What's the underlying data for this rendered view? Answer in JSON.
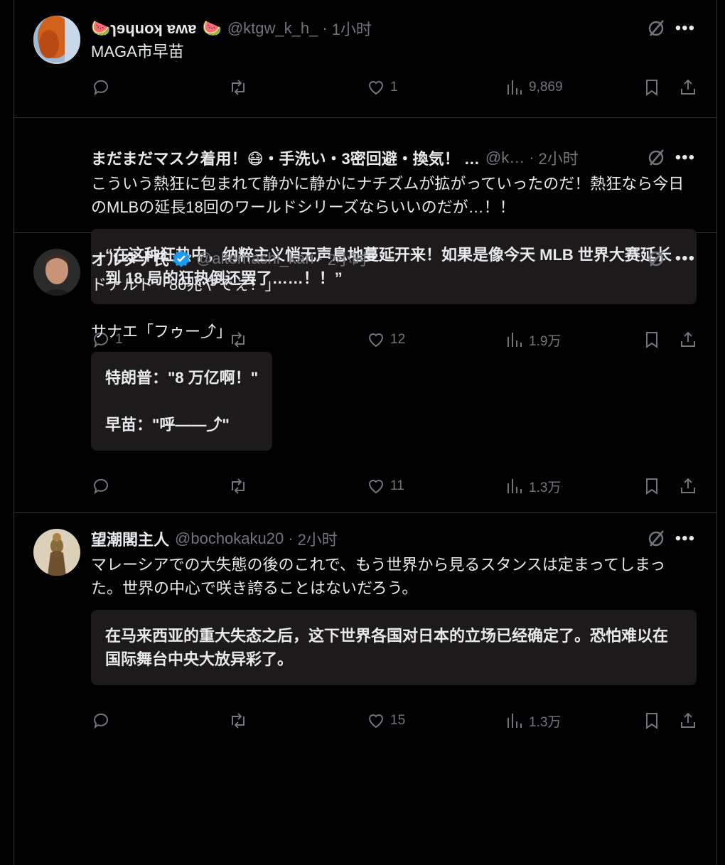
{
  "posts": [
    {
      "name": "🍉ɿɘɥuoʞ ɐʍɐ",
      "name_suffix": "🍉",
      "handle": "@ktgw_k_h_",
      "time": "1小时",
      "text": "MAGA市早苗",
      "translation": "",
      "replies": "",
      "reposts": "",
      "likes": "1",
      "views": "9,869"
    },
    {
      "name": "まだまだマスク着用！😷・手洗い・3密回避・換気！ …",
      "handle": "@k…",
      "time": "2小时",
      "text": "こういう熱狂に包まれて静かに静かにナチズムが拡がっていったのだ！熱狂なら今日のMLBの延長18回のワールドシリーズならいいのだが…！！",
      "translation": "“在这种狂热中，纳粹主义悄无声息地蔓延开来！如果是像今天 MLB 世界大赛延长到 18 局的狂热倒还罢了……！！”",
      "replies": "1",
      "reposts": "",
      "likes": "12",
      "views": "1.9万"
    },
    {
      "name": "オルタナ氏",
      "handle": "@alternashi_kari",
      "time": "2小时",
      "text": "ドナルド「80兆やでぇ！」\n\nサナエ「フゥー⤴」",
      "translation": "特朗普：\"8 万亿啊！\"\n\n早苗：\"呼——⤴\"",
      "replies": "",
      "reposts": "",
      "likes": "11",
      "views": "1.3万"
    },
    {
      "name": "望潮閣主人",
      "handle": "@bochokaku20",
      "time": "2小时",
      "text": "マレーシアでの大失態の後のこれで、もう世界から見るスタンスは定まってしまった。世界の中心で咲き誇ることはないだろう。",
      "translation": "在马来西亚的重大失态之后，这下世界各国对日本的立场已经确定了。恐怕难以在国际舞台中央大放异彩了。",
      "replies": "",
      "reposts": "",
      "likes": "15",
      "views": "1.3万"
    }
  ],
  "colors": {
    "bg": "#000000",
    "text": "#e7e9ea",
    "muted": "#71767b",
    "verified": "#1d9bf0",
    "card": "#1d1a1b"
  },
  "icons": [
    "reply-icon",
    "repost-icon",
    "like-icon",
    "views-icon",
    "bookmark-icon",
    "share-icon",
    "grok-icon",
    "more-icon",
    "verified-icon"
  ]
}
